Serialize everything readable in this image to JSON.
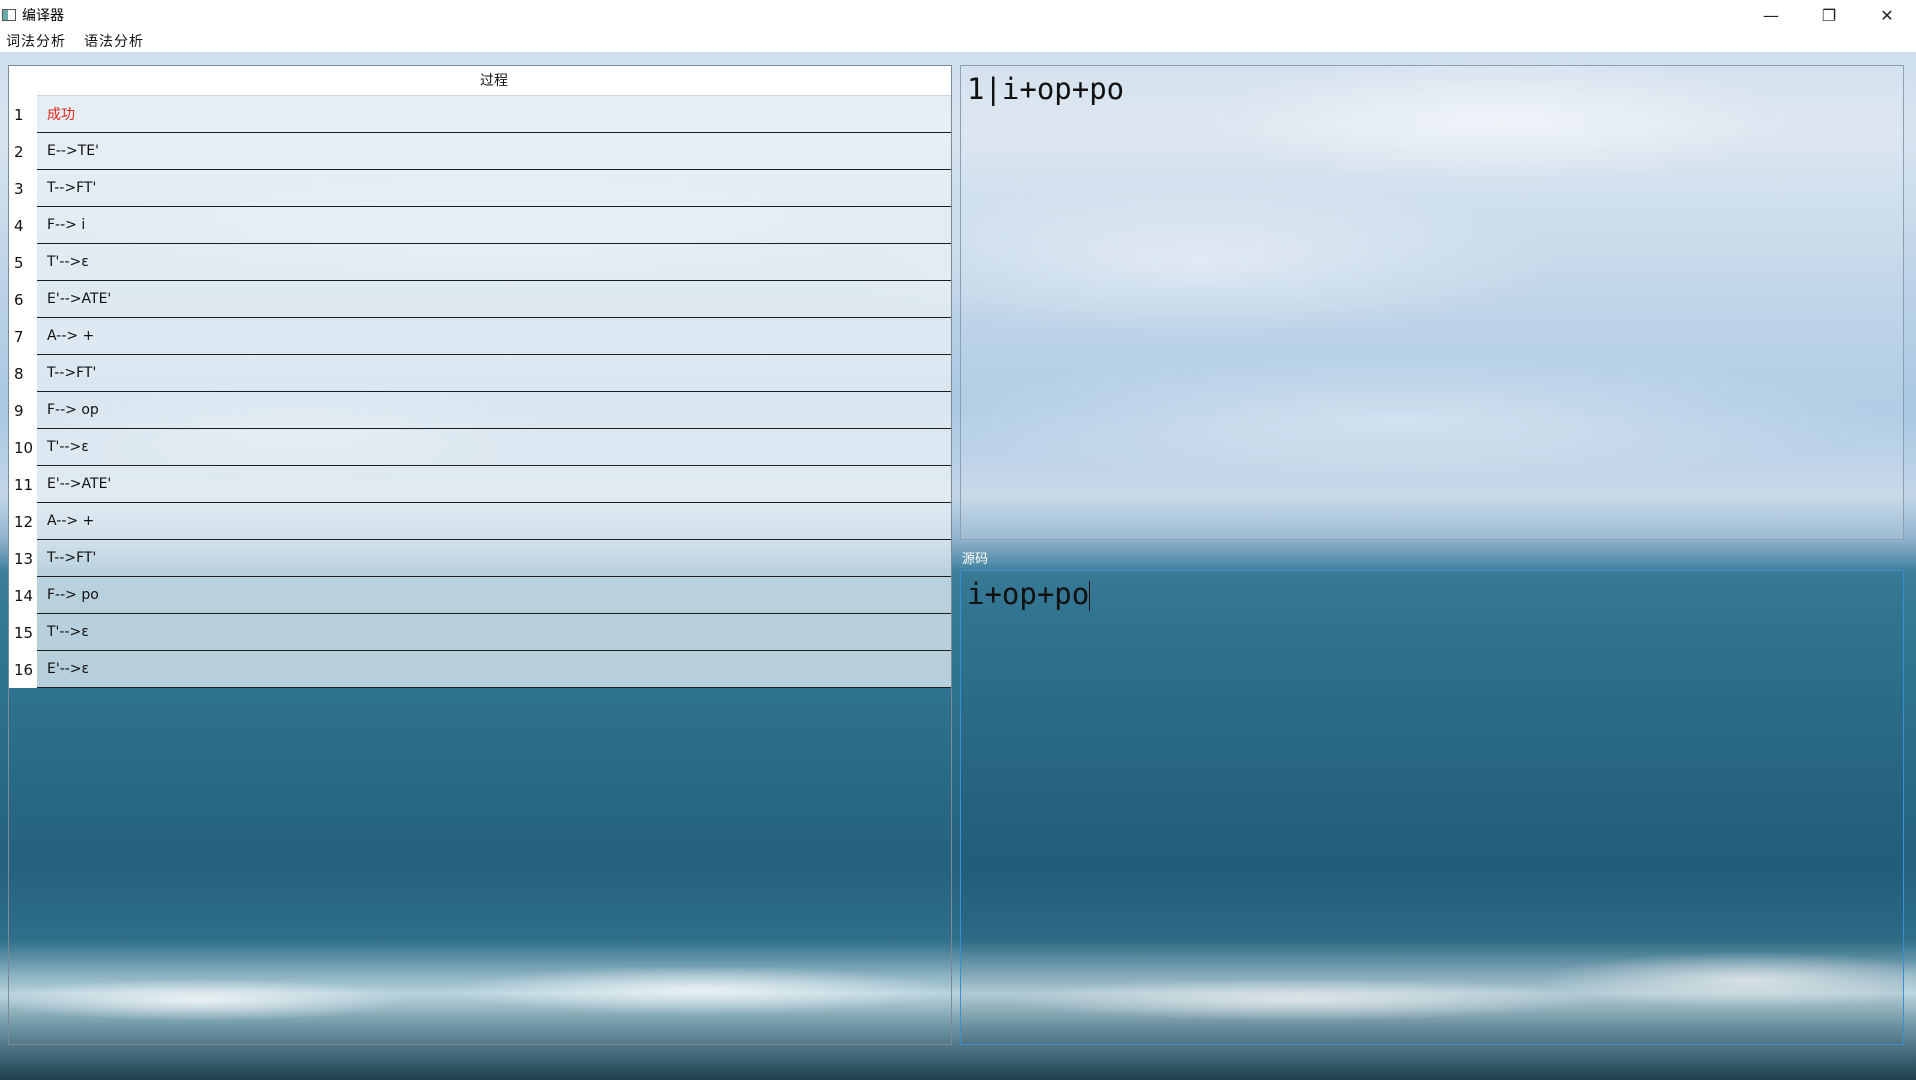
{
  "window": {
    "title": "编译器",
    "controls": {
      "minimize": "—",
      "restore": "❐",
      "close": "✕"
    }
  },
  "menu": [
    {
      "label": "词法分析"
    },
    {
      "label": "语法分析"
    }
  ],
  "process_table": {
    "header": "过程",
    "rows": [
      {
        "num": "1",
        "text": "成功"
      },
      {
        "num": "2",
        "text": "E-->TE'"
      },
      {
        "num": "3",
        "text": "T-->FT'"
      },
      {
        "num": "4",
        "text": "F--> i"
      },
      {
        "num": "5",
        "text": "T'-->ε"
      },
      {
        "num": "6",
        "text": "E'-->ATE'"
      },
      {
        "num": "7",
        "text": "A--> +"
      },
      {
        "num": "8",
        "text": "T-->FT'"
      },
      {
        "num": "9",
        "text": "F--> op"
      },
      {
        "num": "10",
        "text": "T'-->ε"
      },
      {
        "num": "11",
        "text": "E'-->ATE'"
      },
      {
        "num": "12",
        "text": "A--> +"
      },
      {
        "num": "13",
        "text": "T-->FT'"
      },
      {
        "num": "14",
        "text": "F--> po"
      },
      {
        "num": "15",
        "text": "T'-->ε"
      },
      {
        "num": "16",
        "text": "E'-->ε"
      }
    ]
  },
  "output": {
    "text": "1|i+op+po"
  },
  "source": {
    "label": "源码",
    "text": "i+op+po"
  },
  "colors": {
    "success": "#e0241a",
    "focus_border": "#3a8fd0"
  }
}
